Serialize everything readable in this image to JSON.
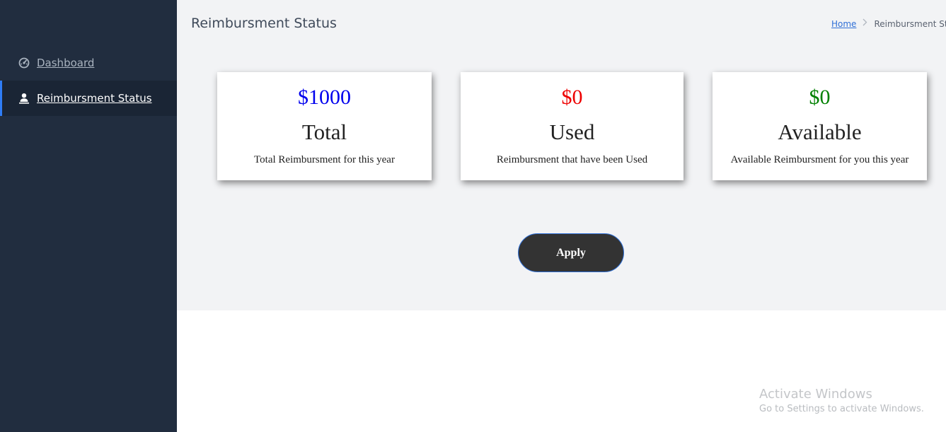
{
  "sidebar": {
    "items": [
      {
        "label": "Dashboard",
        "icon": "dashboard-gauge-icon",
        "active": false
      },
      {
        "label": "Reimbursment Status",
        "icon": "user-icon",
        "active": true
      }
    ]
  },
  "header": {
    "title": "Reimbursment Status",
    "breadcrumb": {
      "home": "Home",
      "separator": ">",
      "current": "Reimbursment Status"
    }
  },
  "cards": [
    {
      "amount": "$1000",
      "name": "Total",
      "description": "Total Reimbursment for this year",
      "amount_color": "#0000ee"
    },
    {
      "amount": "$0",
      "name": "Used",
      "description": "Reimbursment that have been Used",
      "amount_color": "#ee0000"
    },
    {
      "amount": "$0",
      "name": "Available",
      "description": "Available Reimbursment for you this year",
      "amount_color": "#008000"
    }
  ],
  "actions": {
    "apply_label": "Apply"
  },
  "watermark": {
    "title": "Activate Windows",
    "subtitle": "Go to Settings to activate Windows."
  },
  "colors": {
    "sidebar_bg": "#212d3f",
    "active_accent": "#2f7df6",
    "content_bg": "#f2f3f5",
    "button_bg": "#333333"
  }
}
